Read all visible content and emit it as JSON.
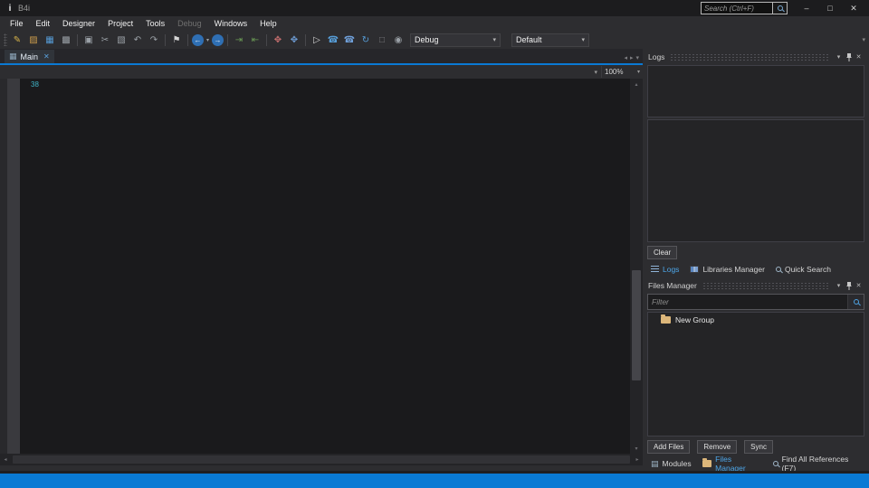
{
  "titlebar": {
    "app_title": "B4i",
    "app_icon_glyph": "i",
    "search_placeholder": "Search (Ctrl+F)",
    "minimize": "–",
    "maximize": "□",
    "close": "✕"
  },
  "menu": {
    "items": [
      {
        "label": "File"
      },
      {
        "label": "Edit"
      },
      {
        "label": "Designer"
      },
      {
        "label": "Project"
      },
      {
        "label": "Tools"
      },
      {
        "label": "Debug",
        "disabled": true
      },
      {
        "label": "Windows"
      },
      {
        "label": "Help"
      }
    ]
  },
  "toolbar": {
    "build_mode": "Debug",
    "build_config": "Default",
    "icons": [
      {
        "name": "new",
        "glyph": "✎"
      },
      {
        "name": "open",
        "glyph": "▨"
      },
      {
        "name": "save",
        "glyph": "▦"
      },
      {
        "name": "save-all",
        "glyph": "▩"
      },
      {
        "name": "copy",
        "glyph": "▣"
      },
      {
        "name": "cut",
        "glyph": "✂"
      },
      {
        "name": "paste",
        "glyph": "▧"
      },
      {
        "name": "undo",
        "glyph": "↶"
      },
      {
        "name": "redo",
        "glyph": "↷"
      },
      {
        "name": "bookmark",
        "glyph": "⚑"
      },
      {
        "name": "navigate-back",
        "glyph": "←"
      },
      {
        "name": "nav-history",
        "glyph": "▾"
      },
      {
        "name": "navigate-forward",
        "glyph": "→"
      },
      {
        "name": "comment",
        "glyph": "⇥"
      },
      {
        "name": "uncomment",
        "glyph": "⇤"
      },
      {
        "name": "reformat",
        "glyph": "✥"
      },
      {
        "name": "find-references",
        "glyph": "✥"
      },
      {
        "name": "run",
        "glyph": "▷"
      },
      {
        "name": "bridge",
        "glyph": "☎"
      },
      {
        "name": "deploy",
        "glyph": "☎"
      },
      {
        "name": "rebuild",
        "glyph": "↻"
      },
      {
        "name": "stop",
        "glyph": "□"
      },
      {
        "name": "logs-globe",
        "glyph": "◉"
      }
    ]
  },
  "editor": {
    "tab_label": "Main",
    "tab_close": "✕",
    "tab_icon": "▦",
    "zoom_level": "100%",
    "code_text": "38"
  },
  "logs_panel": {
    "title": "Logs",
    "clear_button": "Clear",
    "tabs": [
      {
        "label": "Logs",
        "active": true
      },
      {
        "label": "Libraries Manager",
        "active": false
      },
      {
        "label": "Quick Search",
        "active": false
      }
    ]
  },
  "files_panel": {
    "title": "Files Manager",
    "filter_placeholder": "Filter",
    "tree_items": [
      {
        "label": "New Group"
      }
    ],
    "buttons": [
      "Add Files",
      "Remove",
      "Sync"
    ]
  },
  "bottom_tabs": [
    {
      "label": "Modules",
      "active": false
    },
    {
      "label": "Files Manager",
      "active": true
    },
    {
      "label": "Find All References (F7)",
      "active": false
    }
  ],
  "glyphs": {
    "caret_down": "▾",
    "scroll_left": "◂",
    "scroll_right": "▸",
    "scroll_up": "▴",
    "scroll_down": "▾",
    "modules_tab_icon": "▤"
  },
  "colors": {
    "accent_blue": "#0a7ad4",
    "active_tab_text": "#4da6e8",
    "folder": "#dcb67a",
    "code_number": "#3fb3c6"
  }
}
